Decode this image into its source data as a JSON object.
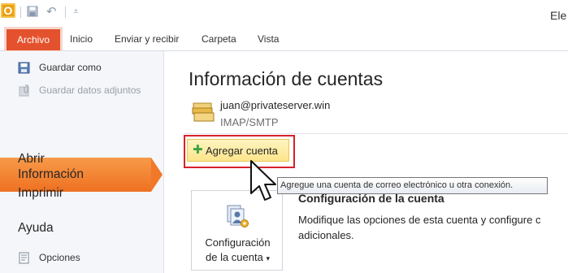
{
  "app": {
    "window_title": "Ele"
  },
  "quick_access": {
    "logo_letter": "O",
    "icons": [
      "save-icon",
      "undo-icon",
      "customize-qat-icon"
    ]
  },
  "ribbon": {
    "tabs": [
      {
        "label": "Archivo",
        "active": true
      },
      {
        "label": "Inicio"
      },
      {
        "label": "Enviar y recibir"
      },
      {
        "label": "Carpeta"
      },
      {
        "label": "Vista"
      }
    ]
  },
  "backstage": {
    "commands": [
      {
        "label": "Guardar como",
        "icon": "save-as-icon",
        "enabled": true
      },
      {
        "label": "Guardar datos adjuntos",
        "icon": "save-attachments-icon",
        "enabled": false
      }
    ],
    "items": [
      {
        "label": "Información",
        "selected": true
      },
      {
        "label": "Abrir"
      },
      {
        "label": "Imprimir"
      },
      {
        "label": "Ayuda"
      }
    ],
    "footer_commands": [
      {
        "label": "Opciones",
        "icon": "options-icon"
      }
    ]
  },
  "main": {
    "title": "Información de cuentas",
    "account": {
      "email": "juan@privateserver.win",
      "type": "IMAP/SMTP",
      "icon": "account-folder-icon"
    },
    "add_account_label": "Agregar cuenta",
    "tooltip": "Agregue una cuenta de correo electrónico u otra conexión.",
    "settings_button": {
      "line1": "Configuración",
      "line2": "de la cuenta",
      "dropdown_glyph": "▾"
    },
    "settings_section": {
      "title": "Configuración de la cuenta",
      "description_line1": "Modifique las opciones de esta cuenta y configure c",
      "description_line2": "adicionales."
    }
  },
  "colors": {
    "file_tab": "#e4522d",
    "selected_nav": "#f3802e",
    "highlight_border": "#d8202c",
    "add_button": "#fde58b"
  }
}
